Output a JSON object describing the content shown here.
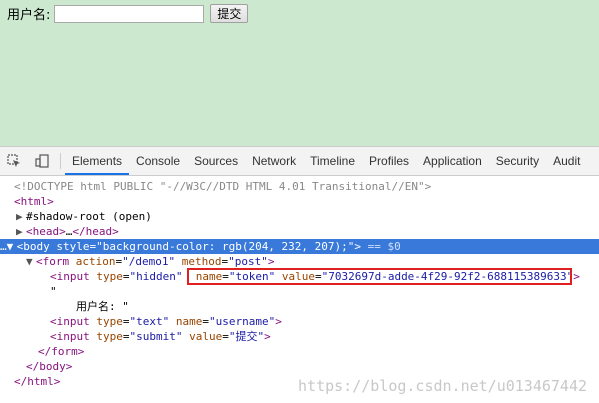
{
  "preview": {
    "background": "#cce8cf",
    "username_label": "用户名:",
    "submit_label": "提交"
  },
  "devtools": {
    "tabs": [
      "Elements",
      "Console",
      "Sources",
      "Network",
      "Timeline",
      "Profiles",
      "Application",
      "Security",
      "Audit"
    ],
    "active_tab": "Elements",
    "dom": {
      "doctype": "<!DOCTYPE html PUBLIC \"-//W3C//DTD HTML 4.01 Transitional//EN\">",
      "html_open": "<html>",
      "shadow_root": "#shadow-root (open)",
      "head_tag_open": "<head>",
      "head_ellipsis": "…",
      "head_tag_close": "</head>",
      "body_prefix": "…",
      "body_tag_open": "<body",
      "body_attr_name": "style",
      "body_attr_value": "\"background-color: rgb(204, 232, 207);\"",
      "body_tag_end": ">",
      "body_dollar": " == $0",
      "form_open": "<form",
      "form_attr1_name": "action",
      "form_attr1_value": "\"/demo1\"",
      "form_attr2_name": "method",
      "form_attr2_value": "\"post\"",
      "form_tag_end": ">",
      "input1_open": "<input",
      "input1_attr1_name": "type",
      "input1_attr1_value": "\"hidden\"",
      "input1_attr2_name": "name",
      "input1_attr2_value": "\"token\"",
      "input1_attr3_name": "value",
      "input1_attr3_value": "\"7032697d-adde-4f29-92f2-688115389633\"",
      "input1_end": ">",
      "quote_open": "\"",
      "text_node": "用户名: \"",
      "input2_open": "<input",
      "input2_attr1_name": "type",
      "input2_attr1_value": "\"text\"",
      "input2_attr2_name": "name",
      "input2_attr2_value": "\"username\"",
      "input2_end": ">",
      "input3_open": "<input",
      "input3_attr1_name": "type",
      "input3_attr1_value": "\"submit\"",
      "input3_attr2_name": "value",
      "input3_attr2_value": "\"提交\"",
      "input3_end": ">",
      "form_close": "</form>",
      "body_close": "</body>",
      "html_close": "</html>"
    },
    "highlight_color": "#e02020"
  },
  "watermark": "https://blog.csdn.net/u013467442"
}
